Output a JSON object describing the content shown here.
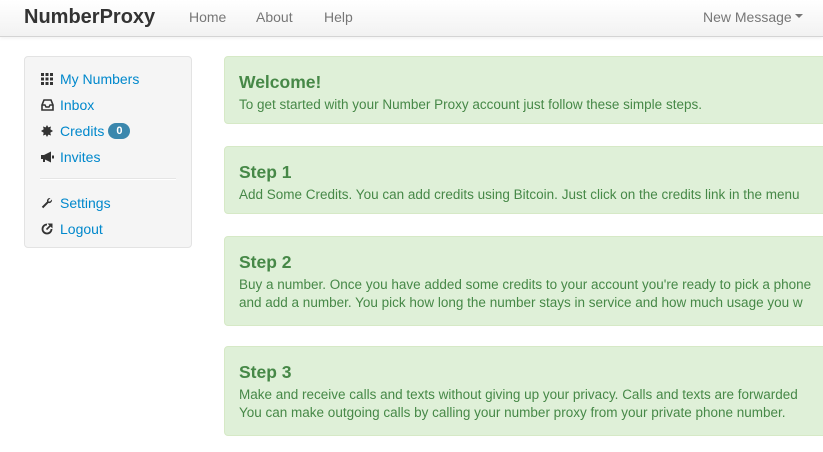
{
  "navbar": {
    "brand": "NumberProxy",
    "links": [
      "Home",
      "About",
      "Help"
    ],
    "dropdown_label": "New Message"
  },
  "sidebar": {
    "items": [
      {
        "label": "My Numbers",
        "icon": "grid-icon"
      },
      {
        "label": "Inbox",
        "icon": "inbox-icon"
      },
      {
        "label": "Credits",
        "icon": "certificate-icon",
        "badge": "0"
      },
      {
        "label": "Invites",
        "icon": "bullhorn-icon"
      },
      {
        "label": "Settings",
        "icon": "wrench-icon"
      },
      {
        "label": "Logout",
        "icon": "share-icon"
      }
    ]
  },
  "alerts": [
    {
      "title": "Welcome!",
      "lines": [
        "To get started with your Number Proxy account just follow these simple steps."
      ]
    },
    {
      "title": "Step 1",
      "lines": [
        "Add Some Credits. You can add credits using Bitcoin. Just click on the credits link in the menu"
      ]
    },
    {
      "title": "Step 2",
      "lines": [
        "Buy a number. Once you have added some credits to your account you're ready to pick a phone",
        "and add a number. You pick how long the number stays in service and how much usage you w"
      ]
    },
    {
      "title": "Step 3",
      "lines": [
        "Make and receive calls and texts without giving up your privacy. Calls and texts are forwarded",
        "You can make outgoing calls by calling your number proxy from your private phone number."
      ]
    }
  ]
}
